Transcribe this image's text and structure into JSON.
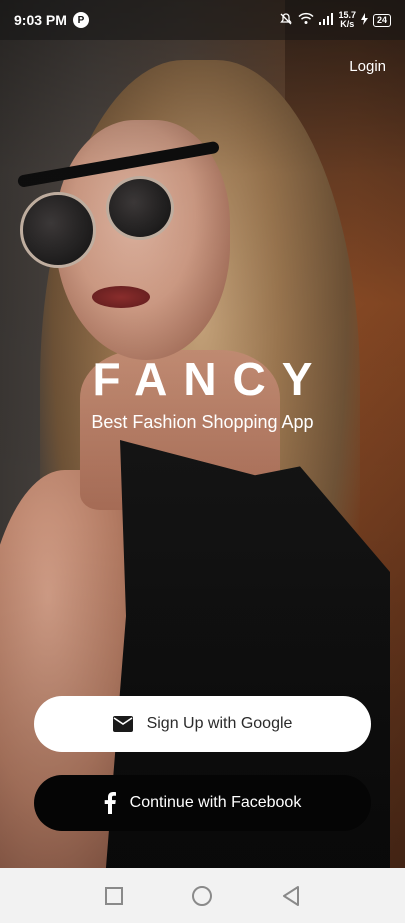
{
  "status_bar": {
    "time": "9:03 PM",
    "app_icon_letter": "P",
    "net_speed_value": "15.7",
    "net_speed_unit": "K/s",
    "battery_level": "24"
  },
  "header": {
    "login_label": "Login"
  },
  "brand": {
    "title": "FANCY",
    "tagline": "Best Fashion Shopping App"
  },
  "actions": {
    "google_label": "Sign Up with Google",
    "facebook_label": "Continue with Facebook"
  },
  "icons": {
    "google_button_icon": "mail-icon",
    "facebook_button_icon": "facebook-icon",
    "nav_recent": "square-icon",
    "nav_home": "circle-icon",
    "nav_back": "triangle-back-icon"
  },
  "colors": {
    "google_button_bg": "#ffffff",
    "facebook_button_bg": "#050505",
    "nav_bar_bg": "#f2f2f2"
  }
}
